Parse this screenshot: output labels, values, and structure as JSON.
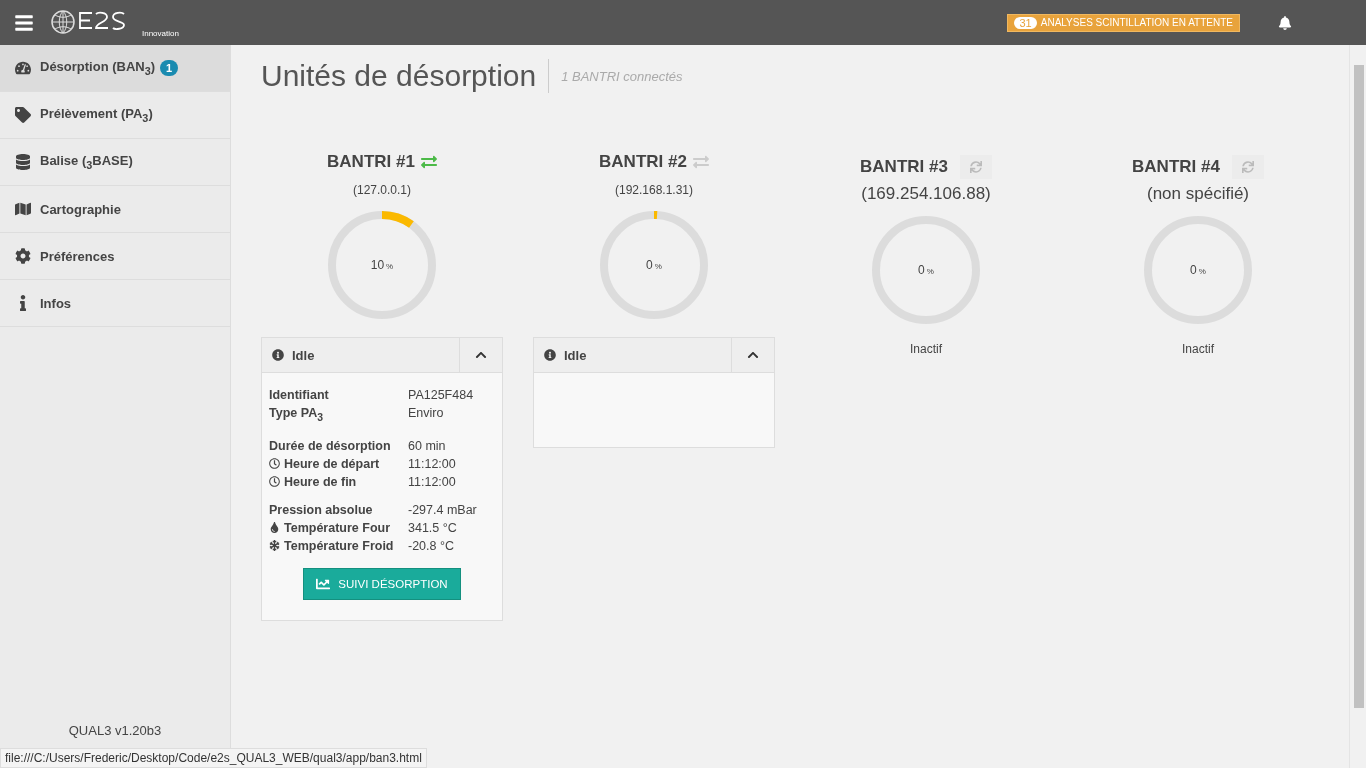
{
  "topbar": {
    "logo_text": "Innovation",
    "alert": {
      "count": "31",
      "label": "ANALYSES SCINTILLATION EN ATTENTE"
    }
  },
  "sidebar": {
    "items": [
      {
        "label": "Désorption (BAN$_{3}$)",
        "selected": true,
        "badge": "1"
      },
      {
        "label": "Prélèvement (PA$_{3}$)",
        "selected": false
      },
      {
        "label": "Balise ($_{3}$BASE)",
        "selected": false
      },
      {
        "label": "Cartographie",
        "selected": false
      },
      {
        "label": "Préférences",
        "selected": false
      },
      {
        "label": "Infos",
        "selected": false
      }
    ],
    "version": "QUAL3 v1.20b3"
  },
  "page": {
    "title": "Unités de désorption",
    "subtitle": "1 BANTRI connectés"
  },
  "units": [
    {
      "name": "BANTRI #1",
      "kind": "active",
      "connected": true,
      "address": "(127.0.0.1)",
      "level": 0.1,
      "percent": "10",
      "unit": "%",
      "panel": {
        "title": "Idle",
        "expanded": true,
        "groups": [
          [
            {
              "kind": "plain",
              "label": "Identifiant",
              "value": "PA125F484"
            },
            {
              "kind": "plain",
              "label": "Type PA$_{3}$",
              "value": "Enviro"
            }
          ],
          [
            {
              "kind": "plain",
              "label": "Durée de désorption",
              "value": "60 min"
            },
            {
              "kind": "time",
              "label": "Heure de départ",
              "value": "11:12:00"
            },
            {
              "kind": "time",
              "label": "Heure de fin",
              "value": "11:12:00"
            }
          ],
          [
            {
              "kind": "plain",
              "label": "Pression absolue",
              "value": "-297.4 mBar"
            },
            {
              "kind": "hot",
              "label": "Température Four",
              "value": "341.5 °C"
            },
            {
              "kind": "cold",
              "label": "Température Froid",
              "value": "-20.8 °C"
            }
          ]
        ],
        "button": "SUIVI DÉSORPTION"
      }
    },
    {
      "name": "BANTRI #2",
      "kind": "active",
      "connected": false,
      "address": "(192.168.1.31)",
      "level": 0.01,
      "percent": "0",
      "unit": "%",
      "panel": {
        "title": "Idle",
        "expanded": true
      }
    },
    {
      "name": "BANTRI #3",
      "kind": "inactive",
      "address": "(169.254.106.88)",
      "level": 0,
      "percent": "0",
      "unit": "%",
      "status": "Inactif"
    },
    {
      "name": "BANTRI #4",
      "kind": "inactive",
      "address": "(non spécifié)",
      "level": 0,
      "percent": "0",
      "unit": "%",
      "status": "Inactif"
    }
  ],
  "status_url": "file:///C:/Users/Frederic/Desktop/Code/e2s_QUAL3_WEB/qual3/app/ban3.html"
}
